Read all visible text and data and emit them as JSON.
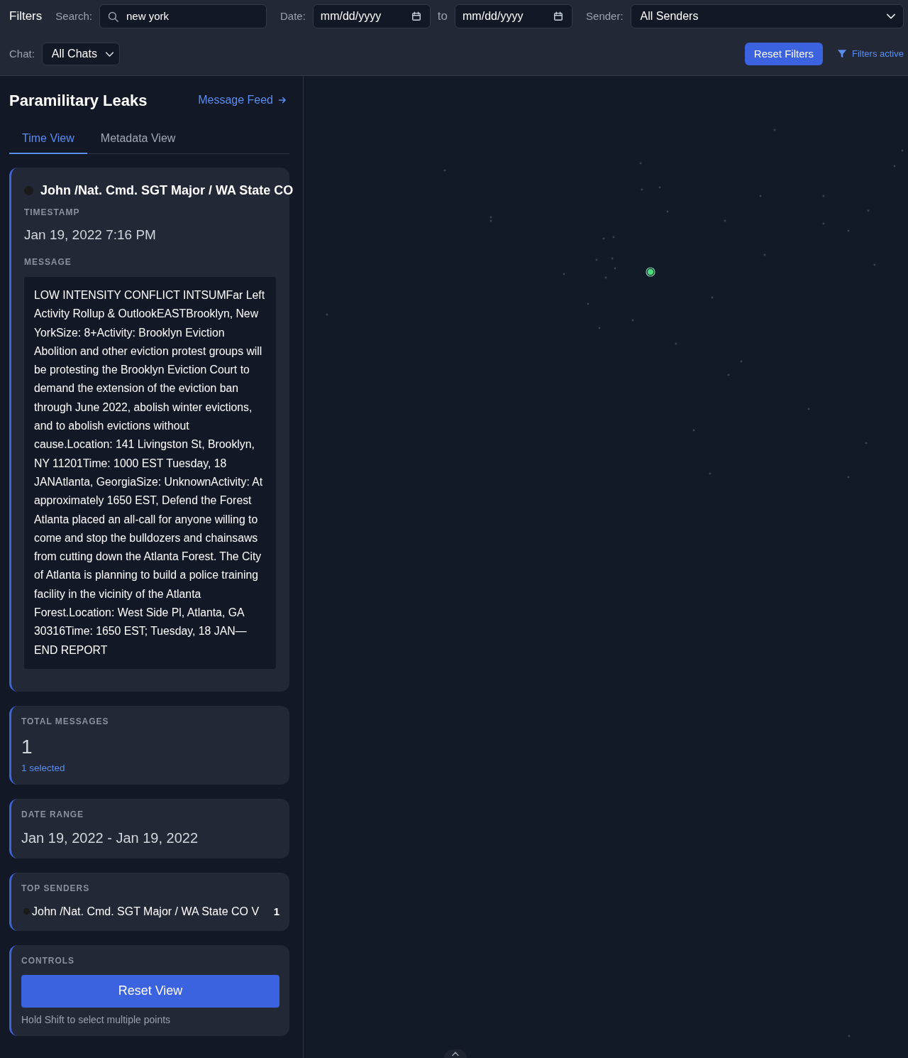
{
  "filters": {
    "title": "Filters",
    "search": {
      "label": "Search:",
      "value": "new york"
    },
    "date": {
      "label": "Date:",
      "from": {
        "placeholder": "mm/dd/yyyy"
      },
      "separator": "to",
      "to": {
        "placeholder": "mm/dd/yyyy"
      }
    },
    "sender": {
      "label": "Sender:",
      "value": "All Senders"
    },
    "chat": {
      "label": "Chat:",
      "value": "All Chats"
    },
    "reset_button": "Reset Filters",
    "status": "Filters active"
  },
  "panel": {
    "title": "Paramilitary Leaks",
    "link": "Message Feed",
    "tabs": [
      {
        "label": "Time View",
        "selected": true
      },
      {
        "label": "Metadata View",
        "selected": false
      }
    ]
  },
  "message_card": {
    "sender": {
      "name": "John /Nat. Cmd. SGT Major / WA State CO",
      "color": "#1a1a1a"
    },
    "timestamp_label": "TIMESTAMP",
    "timestamp": "Jan 19, 2022 7:16 PM",
    "message_label": "MESSAGE",
    "message": "LOW INTENSITY CONFLICT INTSUMFar Left Activity Rollup & OutlookEASTBrooklyn, New YorkSize: 8+Activity: Brooklyn Eviction Abolition and other eviction protest groups will be protesting the Brooklyn Eviction Court to demand the extension of the eviction ban through June 2022, abolish winter evictions, and to abolish evictions without cause.Location: 141 Livingston St, Brooklyn, NY 11201Time: 1000 EST Tuesday, 18 JANAtlanta, GeorgiaSize: UnknownActivity: At approximately 1650 EST, Defend the Forest Atlanta placed an all-call for anyone willing to come and stop the bulldozers and chainsaws from cutting down the Atlanta Forest. The City of Atlanta is planning to build a police training facility in the vicinity of the Atlanta Forest.Location: West Side Pl, Atlanta, GA 30316Time: 1650 EST; Tuesday, 18 JAN— END REPORT"
  },
  "stats": [
    {
      "kind": "count",
      "label": "TOTAL MESSAGES",
      "value": "1",
      "note": "1 selected"
    },
    {
      "kind": "range",
      "label": "DATE RANGE",
      "value": "Jan 19, 2022 - Jan 19, 2022"
    },
    {
      "kind": "senders",
      "label": "TOP SENDERS",
      "senders": [
        {
          "name": "John /Nat. Cmd. SGT Major / WA State CO V",
          "count": "1",
          "color": "#1a1a1a"
        }
      ]
    },
    {
      "kind": "controls",
      "label": "CONTROLS",
      "button": "Reset View",
      "hint": "Hold Shift to select multiple points"
    }
  ],
  "canvas": {
    "points": [
      {
        "selected": true
      },
      {
        "selected": false
      },
      {
        "selected": false
      },
      {
        "selected": false
      },
      {
        "selected": false
      },
      {
        "selected": false
      },
      {
        "selected": false
      },
      {
        "selected": false
      },
      {
        "selected": false
      },
      {
        "selected": false
      },
      {
        "selected": false
      },
      {
        "selected": false
      },
      {
        "selected": false
      },
      {
        "selected": false
      },
      {
        "selected": false
      },
      {
        "selected": false
      },
      {
        "selected": false
      },
      {
        "selected": false
      },
      {
        "selected": false
      },
      {
        "selected": false
      },
      {
        "selected": false
      },
      {
        "selected": false
      },
      {
        "selected": false
      },
      {
        "selected": false
      },
      {
        "selected": false
      },
      {
        "selected": false
      },
      {
        "selected": false
      },
      {
        "selected": false
      },
      {
        "selected": false
      },
      {
        "selected": false
      },
      {
        "selected": false
      },
      {
        "selected": false
      },
      {
        "selected": false
      },
      {
        "selected": false
      },
      {
        "selected": false
      },
      {
        "selected": false
      },
      {
        "selected": false
      },
      {
        "selected": false
      },
      {
        "selected": false
      },
      {
        "selected": false
      }
    ]
  }
}
